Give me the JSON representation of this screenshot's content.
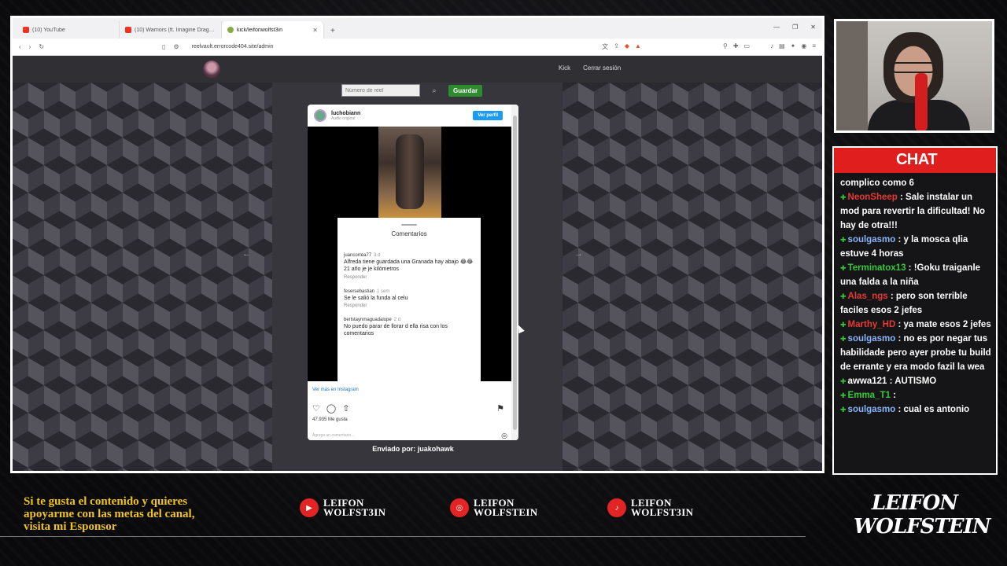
{
  "browser": {
    "tabs": [
      {
        "label": "(10) YouTube",
        "icon": "youtube"
      },
      {
        "label": "(10) Warriors (ft. Imagine Dragons) |",
        "icon": "youtube"
      },
      {
        "label": "kick/leifonwolfst3in",
        "icon": "kick",
        "active": true
      }
    ],
    "url": "reelvault.errorcode404.site/admin"
  },
  "site": {
    "nav": [
      "Kick",
      "Cerrar sesión"
    ],
    "reel_input_placeholder": "Número de reel",
    "save_label": "Guardar",
    "sent_by": "Enviado por: juakohawk"
  },
  "instagram": {
    "username": "luchobiann",
    "audio": "Audio original",
    "follow_label": "Ver perfil",
    "comments_title": "Comentarios",
    "comments": [
      {
        "user": "juancorrea77",
        "time": "3 d",
        "text": "Alfreda tiene guardada una Granada hay abajo 😂😂 21 año je je kilómetros",
        "reply": "Responder"
      },
      {
        "user": "fesersebastian",
        "time": "1 sem",
        "text": "Se le salió la funda al celu",
        "reply": "Responder"
      },
      {
        "user": "berlstaynmaguadalupe",
        "time": "2 d",
        "text": "No puedo parar de llorar d ella risa con los comentarios",
        "reply": ""
      }
    ],
    "more_label": "Ver más en Instagram",
    "likes": "47.935 Me gusta",
    "comment_placeholder": "Agrega un comentario..."
  },
  "chat": {
    "title": "CHAT",
    "messages": [
      {
        "user": "",
        "color": "#ffffff",
        "text": "complico como 6"
      },
      {
        "user": "NeonSheep",
        "color": "#e53935",
        "text": ": Sale instalar un mod para revertir la dificultad! No hay de otra!!!"
      },
      {
        "user": "soulgasmo",
        "color": "#8ab4f8",
        "text": ": y la mosca qlia estuve 4 horas"
      },
      {
        "user": "Terminatox13",
        "color": "#37c83a",
        "text": ": !Goku traiganle una falda a la niña"
      },
      {
        "user": "Alas_ngs",
        "color": "#e53935",
        "text": ": pero son terrible faciles esos 2 jefes"
      },
      {
        "user": "Marthy_HD",
        "color": "#e53935",
        "text": ": ya mate esos 2 jefes"
      },
      {
        "user": "soulgasmo",
        "color": "#8ab4f8",
        "text": ": no es por negar tus habilidade pero ayer probe tu build de errante y era modo fazil la wea"
      },
      {
        "user": "awwa121",
        "color": "#ffffff",
        "text": ": AUTISMO"
      },
      {
        "user": "Emma_T1",
        "color": "#37c83a",
        "text": ":"
      },
      {
        "user": "soulgasmo",
        "color": "#8ab4f8",
        "text": ": cual es antonio"
      }
    ]
  },
  "banner": {
    "sponsor_lines": [
      "Si te gusta el contenido y quieres",
      "apoyarme con las metas del canal,",
      "visita mi Esponsor"
    ],
    "socials": [
      {
        "platform": "youtube",
        "line1": "LEIFON",
        "line2": "WOLFST3IN"
      },
      {
        "platform": "instagram",
        "line1": "LEIFON",
        "line2": "WOLFSTEIN"
      },
      {
        "platform": "tiktok",
        "line1": "LEIFON",
        "line2": "WOLFST3IN"
      }
    ],
    "brand_top": "LEIFON",
    "brand_bottom": "WOLFSTEIN"
  }
}
